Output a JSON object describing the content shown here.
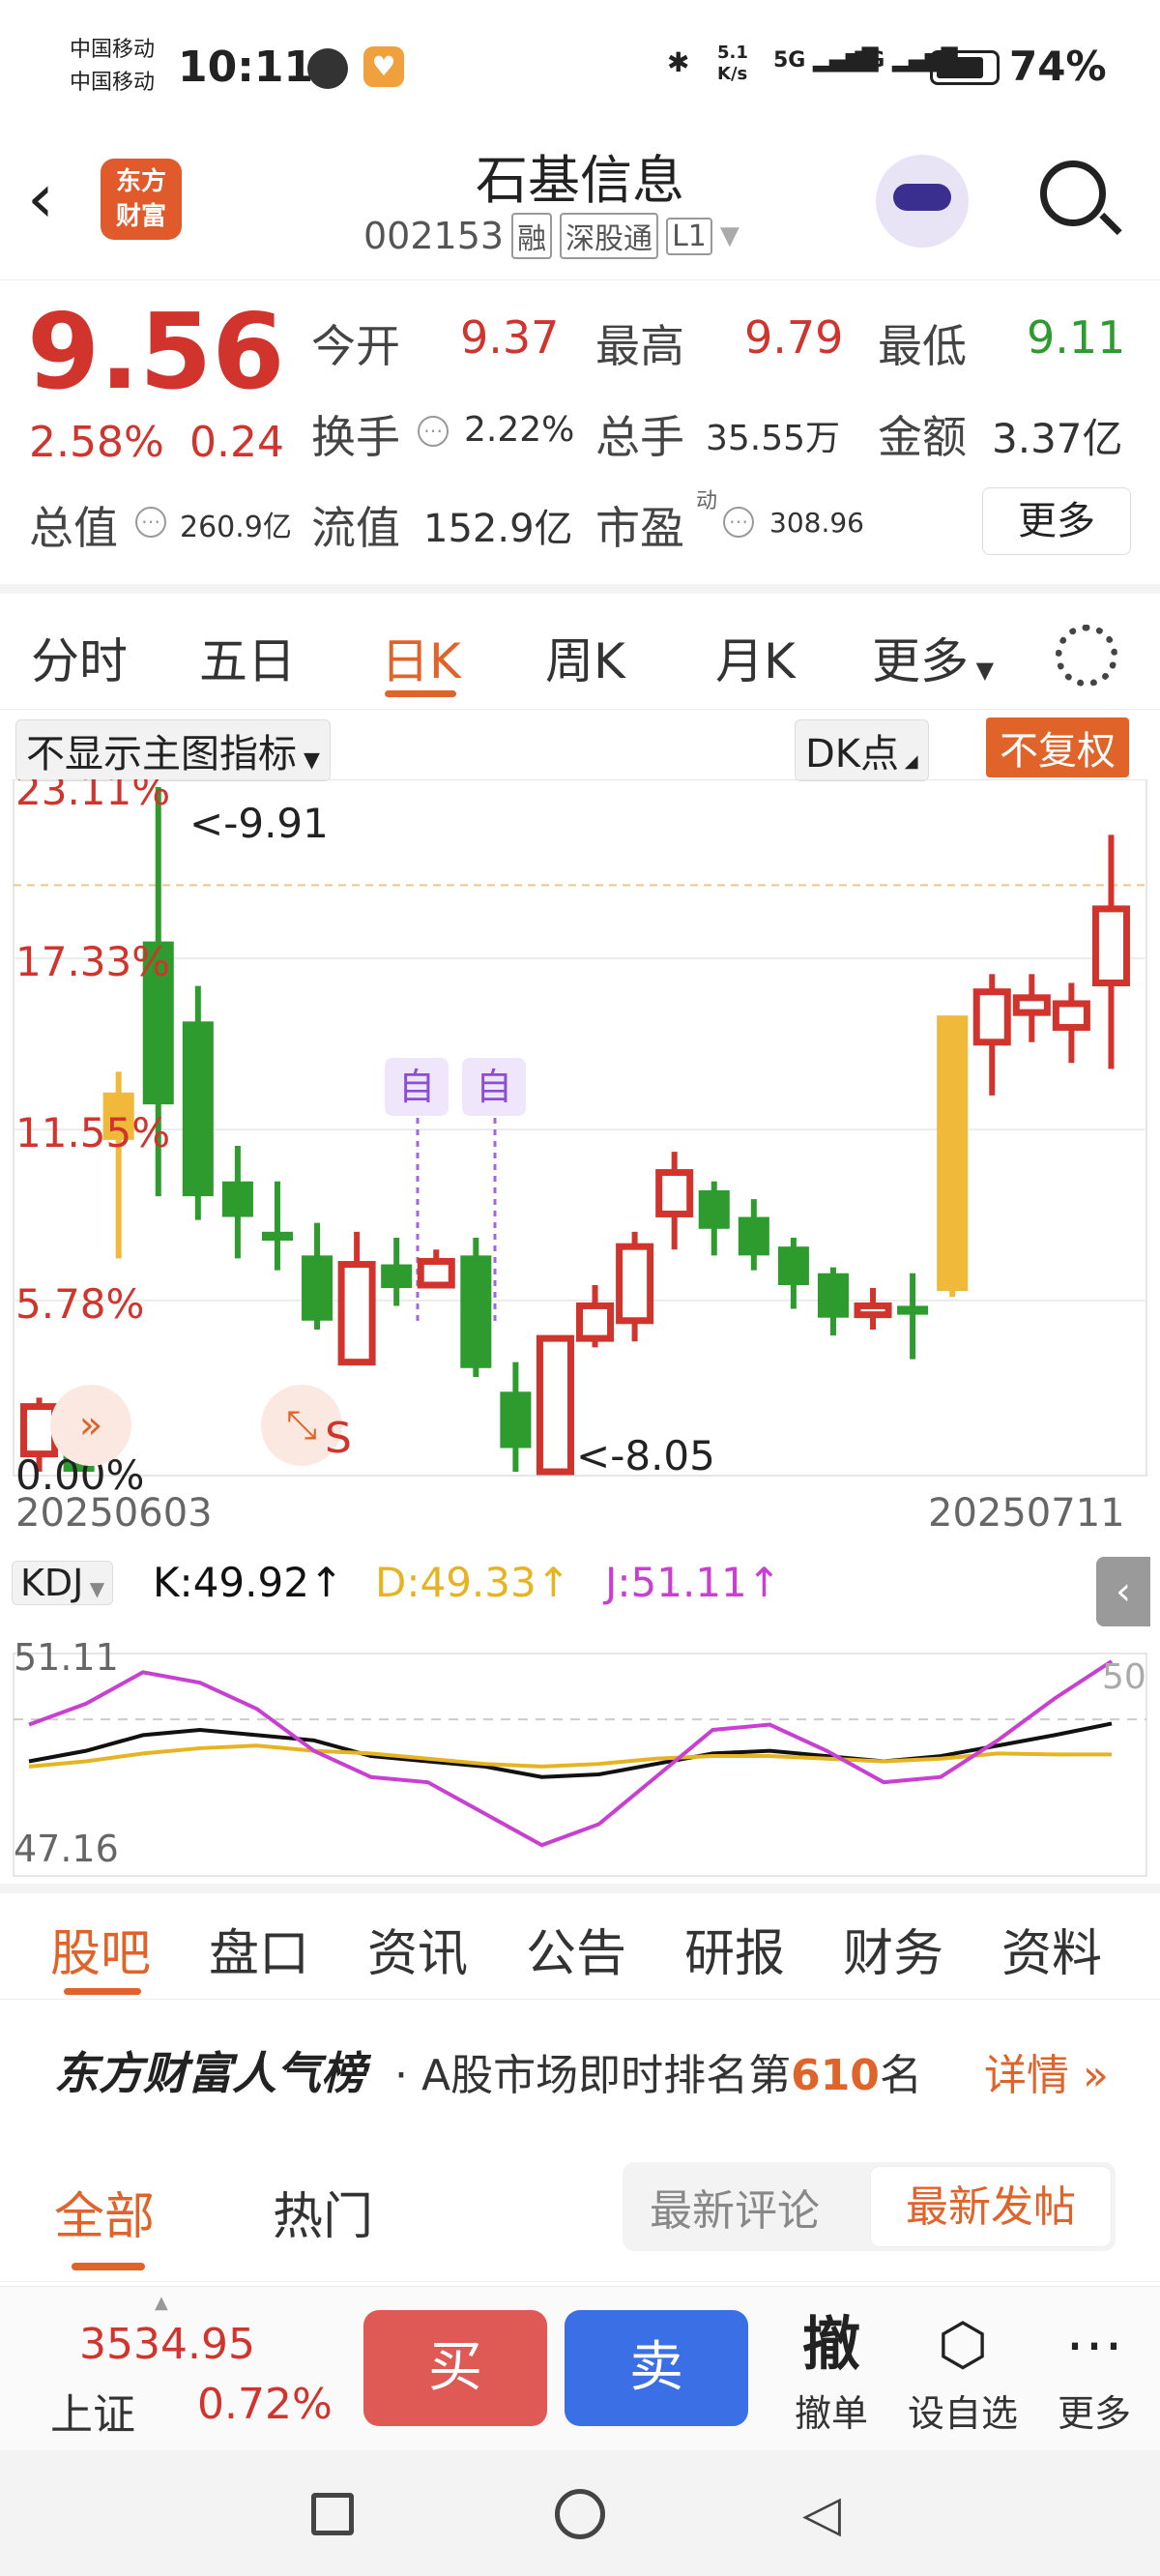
{
  "status_bar": {
    "carrier1": "中国移动",
    "carrier2": "中国移动",
    "time": "10:11",
    "net_speed_top": "5.1",
    "net_speed_bottom": "K/s",
    "signal1": "5G",
    "signal2": "5G",
    "battery": "74%"
  },
  "header": {
    "logo_line1": "东方",
    "logo_line2": "财富",
    "title": "石基信息",
    "code": "002153",
    "tags": [
      "融",
      "深股通",
      "L1"
    ]
  },
  "quote": {
    "price": "9.56",
    "change_pct": "2.58%",
    "change": "0.24",
    "open_label": "今开",
    "open": "9.37",
    "high_label": "最高",
    "high": "9.79",
    "low_label": "最低",
    "low": "9.11",
    "turnover_label": "换手",
    "turnover": "2.22%",
    "volume_label": "总手",
    "volume": "35.55万",
    "amount_label": "金额",
    "amount": "3.37亿",
    "mktcap_label": "总值",
    "mktcap": "260.9亿",
    "float_label": "流值",
    "float": "152.9亿",
    "pe_label": "市盈",
    "pe_sup": "动",
    "pe": "308.96",
    "more_label": "更多"
  },
  "chart_tabs": [
    "分时",
    "五日",
    "日K",
    "周K",
    "月K",
    "更多"
  ],
  "chart_controls": {
    "indicator_select": "不显示主图指标",
    "dk_point": "DK点",
    "no_adjust": "不复权"
  },
  "kline": {
    "y_labels": [
      "23.11%",
      "17.33%",
      "11.55%",
      "5.78%",
      "0.00%"
    ],
    "max_note": "<-9.91",
    "min_note": "<-8.05",
    "x_start": "20250603",
    "x_end": "20250711",
    "markers": [
      "自",
      "自"
    ],
    "s_mark": "S"
  },
  "kdj": {
    "name": "KDJ",
    "k_text": "K:49.92↑",
    "d_text": "D:49.33↑",
    "j_text": "J:51.11↑",
    "y_top": "51.11",
    "y_bottom": "47.16",
    "ref_line": "50"
  },
  "chart_data": [
    {
      "type": "candlestick",
      "title": "",
      "x_range": [
        "20250603",
        "20250711"
      ],
      "y_axis_labels": [
        "23.11%",
        "17.33%",
        "11.55%",
        "5.78%",
        "0.00%"
      ],
      "ylim": [
        0,
        23.11
      ],
      "candles": [
        {
          "o": 0.6,
          "c": 2.2,
          "h": 2.5,
          "l": 0.0
        },
        {
          "o": 1.0,
          "c": 0.0,
          "h": 1.4,
          "l": 0.0
        },
        {
          "o": 11.2,
          "c": 12.8,
          "h": 13.5,
          "l": 7.2
        },
        {
          "o": 17.9,
          "c": 12.4,
          "h": 23.11,
          "l": 9.3
        },
        {
          "o": 15.2,
          "c": 9.3,
          "h": 16.4,
          "l": 8.5
        },
        {
          "o": 9.8,
          "c": 8.6,
          "h": 11.0,
          "l": 7.2
        },
        {
          "o": 8.1,
          "c": 7.8,
          "h": 9.8,
          "l": 6.8
        },
        {
          "o": 7.3,
          "c": 5.1,
          "h": 8.4,
          "l": 4.8
        },
        {
          "o": 3.7,
          "c": 7.0,
          "h": 8.1,
          "l": 3.7
        },
        {
          "o": 7.0,
          "c": 6.2,
          "h": 7.9,
          "l": 5.6
        },
        {
          "o": 6.3,
          "c": 7.1,
          "h": 7.5,
          "l": 6.2
        },
        {
          "o": 7.3,
          "c": 3.5,
          "h": 7.9,
          "l": 3.2
        },
        {
          "o": 2.7,
          "c": 0.8,
          "h": 3.7,
          "l": 0.0
        },
        {
          "o": 0.0,
          "c": 4.5,
          "h": 4.5,
          "l": 0.0
        },
        {
          "o": 4.5,
          "c": 5.6,
          "h": 6.3,
          "l": 4.2
        },
        {
          "o": 5.1,
          "c": 7.6,
          "h": 8.1,
          "l": 4.4
        },
        {
          "o": 8.7,
          "c": 10.1,
          "h": 10.8,
          "l": 7.5
        },
        {
          "o": 9.5,
          "c": 8.2,
          "h": 9.8,
          "l": 7.3
        },
        {
          "o": 8.6,
          "c": 7.3,
          "h": 9.2,
          "l": 6.8
        },
        {
          "o": 7.6,
          "c": 6.3,
          "h": 7.9,
          "l": 5.5
        },
        {
          "o": 6.7,
          "c": 5.2,
          "h": 6.9,
          "l": 4.6
        },
        {
          "o": 5.3,
          "c": 5.6,
          "h": 6.2,
          "l": 4.8
        },
        {
          "o": 5.6,
          "c": 5.3,
          "h": 6.7,
          "l": 3.8
        },
        {
          "o": 6.1,
          "c": 15.4,
          "h": 15.4,
          "l": 5.9
        },
        {
          "o": 14.5,
          "c": 16.2,
          "h": 16.8,
          "l": 12.7
        },
        {
          "o": 15.5,
          "c": 16.0,
          "h": 16.8,
          "l": 14.5
        },
        {
          "o": 15.0,
          "c": 15.8,
          "h": 16.5,
          "l": 13.8
        },
        {
          "o": 16.5,
          "c": 19.0,
          "h": 21.5,
          "l": 13.6
        }
      ]
    },
    {
      "type": "line",
      "title": "KDJ",
      "ylim": [
        47.16,
        51.11
      ],
      "reference_line": 50,
      "series": [
        {
          "name": "K",
          "color": "#111111",
          "values": [
            49.2,
            49.4,
            49.7,
            49.8,
            49.7,
            49.6,
            49.3,
            49.2,
            49.1,
            48.9,
            48.95,
            49.15,
            49.35,
            49.4,
            49.3,
            49.2,
            49.3,
            49.5,
            49.7,
            49.92
          ]
        },
        {
          "name": "D",
          "color": "#e6b422",
          "values": [
            49.1,
            49.2,
            49.35,
            49.45,
            49.5,
            49.4,
            49.35,
            49.25,
            49.15,
            49.1,
            49.15,
            49.25,
            49.3,
            49.3,
            49.25,
            49.2,
            49.25,
            49.35,
            49.33,
            49.33
          ]
        },
        {
          "name": "J",
          "color": "#c83fd1",
          "values": [
            49.9,
            50.3,
            50.9,
            50.7,
            50.2,
            49.4,
            48.9,
            48.8,
            48.2,
            47.6,
            48.0,
            48.9,
            49.8,
            49.9,
            49.4,
            48.8,
            48.9,
            49.6,
            50.4,
            51.11
          ]
        }
      ]
    }
  ],
  "bottom_tabs": [
    "股吧",
    "盘口",
    "资讯",
    "公告",
    "研报",
    "财务",
    "资料"
  ],
  "rank": {
    "brand": "东方财富人气榜",
    "text_pre": "· A股市场即时排名第",
    "rank": "610",
    "text_post": "名",
    "detail": "详情"
  },
  "feed_tabs": {
    "all": "全部",
    "hot": "热门",
    "latest_comment": "最新评论",
    "latest_post": "最新发帖"
  },
  "toolbar": {
    "index_value": "3534.95",
    "index_name": "上证",
    "index_change": "0.72%",
    "buy": "买",
    "sell": "卖",
    "cancel_icon": "撤",
    "cancel": "撤单",
    "watch": "设自选",
    "more": "更多"
  },
  "colors": {
    "up": "#d0342c",
    "down": "#2e9b2e",
    "accent": "#e0632a",
    "sell_blue": "#3a6fe6"
  }
}
